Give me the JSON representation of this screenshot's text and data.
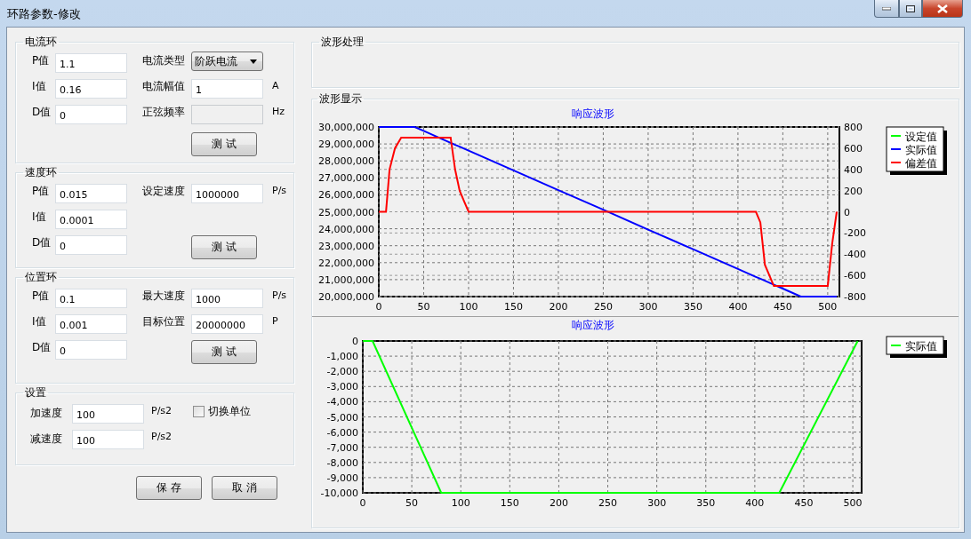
{
  "window": {
    "title": "环路参数-修改"
  },
  "loops": [
    {
      "title": "电流环",
      "pid": [
        {
          "label": "P值",
          "value": "1.1"
        },
        {
          "label": "I值",
          "value": "0.16"
        },
        {
          "label": "D值",
          "value": "0"
        }
      ],
      "params": [
        {
          "kind": "dropdown",
          "label": "电流类型",
          "value": "阶跃电流",
          "disabled": false
        },
        {
          "kind": "input",
          "label": "电流幅值",
          "value": "1",
          "unit": "A",
          "disabled": false
        },
        {
          "kind": "input",
          "label": "正弦频率",
          "unit": "Hz",
          "disabled": true
        }
      ],
      "button": "测 试"
    },
    {
      "title": "速度环",
      "pid": [
        {
          "label": "P值",
          "value": "0.015"
        },
        {
          "label": "I值",
          "value": "0.0001"
        },
        {
          "label": "D值",
          "value": "0"
        }
      ],
      "params": [
        {
          "kind": "input",
          "label": "设定速度",
          "value": "1000000",
          "unit": "P/s",
          "disabled": false
        }
      ],
      "button": "测 试"
    },
    {
      "title": "位置环",
      "pid": [
        {
          "label": "P值",
          "value": "0.1"
        },
        {
          "label": "I值",
          "value": "0.001"
        },
        {
          "label": "D值",
          "value": "0"
        }
      ],
      "params": [
        {
          "kind": "input",
          "label": "最大速度",
          "value": "1000",
          "unit": "P/s",
          "disabled": false
        },
        {
          "kind": "input",
          "label": "目标位置",
          "value": "20000000",
          "unit": "P",
          "disabled": false
        }
      ],
      "button": "测 试"
    }
  ],
  "settings": {
    "title": "设置",
    "fields": [
      {
        "label": "加速度",
        "value": "100",
        "unit": "P/s2"
      },
      {
        "label": "减速度",
        "value": "100",
        "unit": "P/s2"
      }
    ],
    "checkbox": {
      "label": "切换单位",
      "checked": false
    }
  },
  "buttons": [
    "保 存",
    "取 消"
  ],
  "processing_panel": {
    "title": "波形处理"
  },
  "display_panel": {
    "title": "波形显示",
    "charts": [
      {
        "chart_data": {
          "type": "line",
          "title": "响应波形",
          "x": [
            0,
            8,
            12,
            18,
            25,
            35,
            40,
            50,
            65,
            80,
            85,
            90,
            95,
            100,
            150,
            200,
            250,
            300,
            350,
            400,
            420,
            425,
            430,
            440,
            450,
            470,
            490,
            500,
            505,
            510
          ],
          "series": [
            {
              "name": "设定值",
              "color": "#00ff00",
              "values": [
                null,
                null,
                null,
                null,
                null,
                null,
                null,
                null,
                null,
                null,
                null,
                null,
                null,
                null,
                null,
                null,
                null,
                null,
                null,
                null,
                null,
                null,
                null,
                null,
                null,
                null,
                null,
                null,
                null,
                null
              ]
            },
            {
              "name": "实际值",
              "color": "#0000ff",
              "values": [
                30000000,
                30000000,
                30000000,
                30000000,
                30000000,
                30000000,
                30000000,
                29770000,
                29420000,
                29070000,
                28950000,
                28840000,
                28720000,
                28600000,
                27440000,
                26280000,
                25120000,
                23950000,
                22790000,
                21630000,
                21160000,
                21050000,
                20930000,
                20700000,
                20470000,
                20000000,
                20000000,
                20000000,
                20000000,
                20000000
              ]
            },
            {
              "name": "偏差值",
              "color": "#ff0000",
              "axis": "y2",
              "values": [
                0,
                0,
                400,
                600,
                700,
                700,
                700,
                700,
                700,
                700,
                400,
                200,
                100,
                0,
                0,
                0,
                0,
                0,
                0,
                0,
                0,
                -100,
                -500,
                -700,
                -700,
                -700,
                -700,
                -700,
                -300,
                0
              ]
            }
          ],
          "xlim": [
            0,
            513
          ],
          "ylim": [
            20000000,
            30000000
          ],
          "y2lim": [
            -800,
            800
          ],
          "grid": true,
          "legend": "right",
          "xticks": [
            0,
            50,
            100,
            150,
            200,
            250,
            300,
            350,
            400,
            450,
            500
          ],
          "yticks": [
            {
              "value": 20000000,
              "label": "20,000,000"
            },
            {
              "value": 21000000,
              "label": "21,000,000"
            },
            {
              "value": 22000000,
              "label": "22,000,000"
            },
            {
              "value": 23000000,
              "label": "23,000,000"
            },
            {
              "value": 24000000,
              "label": "24,000,000"
            },
            {
              "value": 25000000,
              "label": "25,000,000"
            },
            {
              "value": 26000000,
              "label": "26,000,000"
            },
            {
              "value": 27000000,
              "label": "27,000,000"
            },
            {
              "value": 28000000,
              "label": "28,000,000"
            },
            {
              "value": 29000000,
              "label": "29,000,000"
            },
            {
              "value": 30000000,
              "label": "30,000,000"
            }
          ],
          "y2ticks": [
            -800,
            -600,
            -400,
            -200,
            0,
            200,
            400,
            600,
            800
          ]
        }
      },
      {
        "chart_data": {
          "type": "line",
          "title": "响应波形",
          "x": [
            0,
            10,
            80,
            425,
            505
          ],
          "series": [
            {
              "name": "实际值",
              "color": "#00ff00",
              "values": [
                0,
                0,
                -10000,
                -10000,
                0
              ]
            }
          ],
          "xlim": [
            0,
            509
          ],
          "ylim": [
            -10000,
            0
          ],
          "grid": true,
          "legend": "right",
          "xticks": [
            0,
            50,
            100,
            150,
            200,
            250,
            300,
            350,
            400,
            450,
            500
          ],
          "yticks": [
            {
              "value": -10000,
              "label": "-10,000"
            },
            {
              "value": -9000,
              "label": "-9,000"
            },
            {
              "value": -8000,
              "label": "-8,000"
            },
            {
              "value": -7000,
              "label": "-7,000"
            },
            {
              "value": -6000,
              "label": "-6,000"
            },
            {
              "value": -5000,
              "label": "-5,000"
            },
            {
              "value": -4000,
              "label": "-4,000"
            },
            {
              "value": -3000,
              "label": "-3,000"
            },
            {
              "value": -2000,
              "label": "-2,000"
            },
            {
              "value": -1000,
              "label": "-1,000"
            },
            0
          ]
        }
      }
    ]
  }
}
